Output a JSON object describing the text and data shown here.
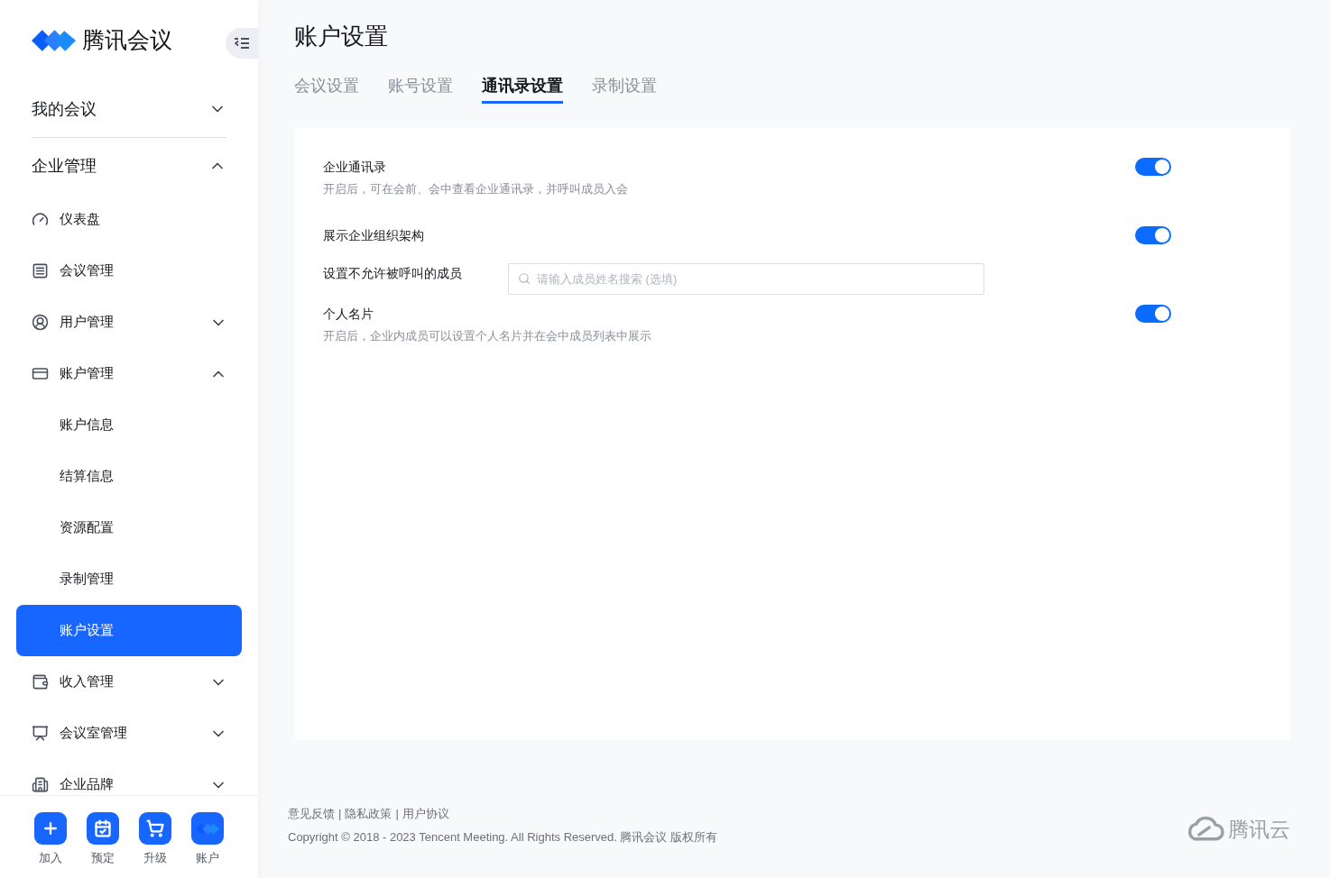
{
  "sidebar": {
    "logo_text": "腾讯会议",
    "sections": [
      {
        "label": "我的会议",
        "expanded": false,
        "selected": false
      },
      {
        "label": "企业管理",
        "expanded": true,
        "selected": false,
        "children": [
          {
            "label": "仪表盘",
            "selected": false
          },
          {
            "label": "会议管理",
            "selected": false
          },
          {
            "label": "用户管理",
            "expanded": false,
            "selected": false
          },
          {
            "label": "账户管理",
            "expanded": true,
            "selected": false,
            "children": [
              {
                "label": "账户信息",
                "selected": false
              },
              {
                "label": "结算信息",
                "selected": false
              },
              {
                "label": "资源配置",
                "selected": false
              },
              {
                "label": "录制管理",
                "selected": false
              },
              {
                "label": "账户设置",
                "selected": true
              }
            ]
          },
          {
            "label": "收入管理",
            "expanded": false,
            "selected": false
          },
          {
            "label": "会议室管理",
            "expanded": false,
            "selected": false
          },
          {
            "label": "企业品牌",
            "expanded": false,
            "selected": false
          }
        ]
      }
    ],
    "bottom_actions": [
      {
        "label": "加入"
      },
      {
        "label": "预定"
      },
      {
        "label": "升级"
      },
      {
        "label": "账户"
      }
    ]
  },
  "page": {
    "title": "账户设置",
    "tabs": [
      {
        "label": "会议设置",
        "selected": false
      },
      {
        "label": "账号设置",
        "selected": false
      },
      {
        "label": "通讯录设置",
        "selected": true
      },
      {
        "label": "录制设置",
        "selected": false
      }
    ],
    "settings": [
      {
        "kind": "toggle",
        "label": "企业通讯录",
        "description": "开启后，可在会前、会中查看企业通讯录，并呼叫成员入会",
        "on": true
      },
      {
        "kind": "toggle",
        "label": "展示企业组织架构",
        "on": true
      },
      {
        "kind": "search",
        "label": "设置不允许被呼叫的成员",
        "placeholder": "请输入成员姓名搜索 (选填)"
      },
      {
        "kind": "toggle",
        "label": "个人名片",
        "description": "开启后，企业内成员可以设置个人名片并在会中成员列表中展示",
        "on": true
      }
    ]
  },
  "footer": {
    "links": [
      "意见反馈",
      "隐私政策",
      "用户协议"
    ],
    "separator": "|",
    "copyright": "Copyright © 2018 - 2023 Tencent Meeting. All Rights Reserved. 腾讯会议 版权所有",
    "brand": "腾讯云"
  }
}
